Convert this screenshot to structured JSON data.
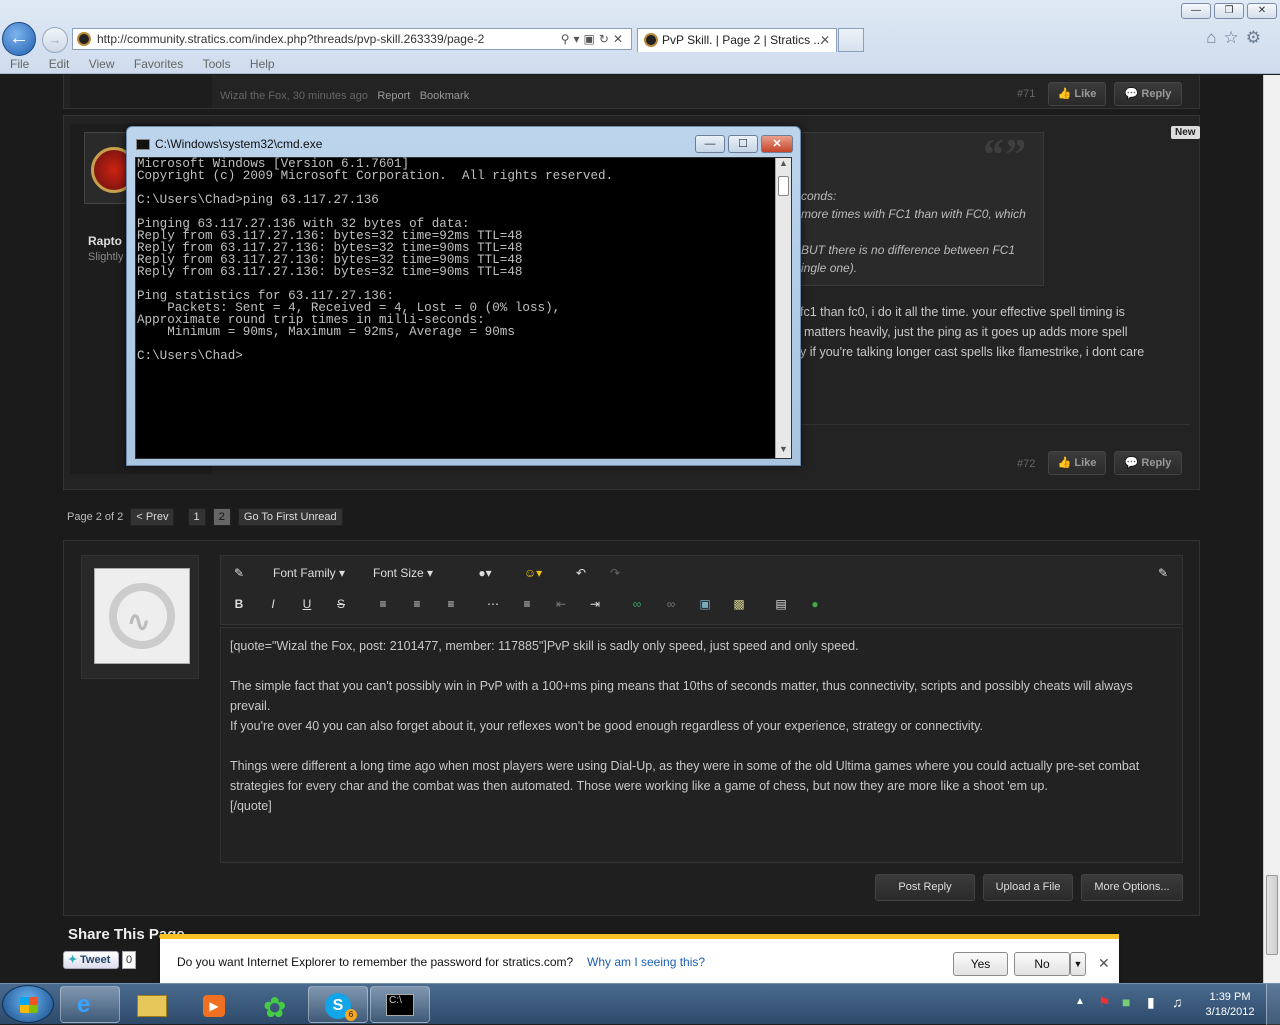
{
  "browser": {
    "url": "http://community.stratics.com/index.php?threads/pvp-skill.263339/page-2",
    "tab_title": "PvP Skill. | Page 2 | Stratics ...",
    "menu": [
      "File",
      "Edit",
      "View",
      "Favorites",
      "Tools",
      "Help"
    ],
    "window_buttons": [
      "minimize",
      "maximize",
      "close"
    ]
  },
  "post71": {
    "byline": "Wizal the Fox, 30 minutes ago",
    "report": "Report",
    "bookmark": "Bookmark",
    "number": "#71",
    "like": "Like",
    "reply": "Reply"
  },
  "post72": {
    "new_badge": "New",
    "author_short": "Rapto",
    "author_rank_short": "Slightly",
    "quote_lines": [
      "conds:",
      "more times with FC1 than with FC0, which",
      "BUT there is no difference between FC1",
      "ingle one)."
    ],
    "body_lines": [
      "fc1 than fc0, i do it all the time. your effective spell timing is",
      "matters heavily, just the ping as it goes up adds more spell",
      "y if you're talking longer cast spells like flamestrike, i dont care"
    ],
    "number": "#72",
    "like": "Like",
    "reply": "Reply"
  },
  "cmd": {
    "title": "C:\\Windows\\system32\\cmd.exe",
    "output": "Microsoft Windows [Version 6.1.7601]\nCopyright (c) 2009 Microsoft Corporation.  All rights reserved.\n\nC:\\Users\\Chad>ping 63.117.27.136\n\nPinging 63.117.27.136 with 32 bytes of data:\nReply from 63.117.27.136: bytes=32 time=92ms TTL=48\nReply from 63.117.27.136: bytes=32 time=90ms TTL=48\nReply from 63.117.27.136: bytes=32 time=90ms TTL=48\nReply from 63.117.27.136: bytes=32 time=90ms TTL=48\n\nPing statistics for 63.117.27.136:\n    Packets: Sent = 4, Received = 4, Lost = 0 (0% loss),\nApproximate round trip times in milli-seconds:\n    Minimum = 90ms, Maximum = 92ms, Average = 90ms\n\nC:\\Users\\Chad>"
  },
  "pagination": {
    "label": "Page 2 of 2",
    "prev": "< Prev",
    "pages": [
      "1",
      "2"
    ],
    "first_unread": "Go To First Unread"
  },
  "editor": {
    "font_family": "Font Family",
    "font_size": "Font Size",
    "text_lines": [
      "[quote=\"Wizal the Fox, post: 2101477, member: 117885\"]PvP skill is sadly only speed, just speed and only speed.",
      "",
      "The simple fact that you can't possibly win in PvP with a 100+ms ping means that 10ths of seconds matter, thus connectivity, scripts and possibly cheats will always prevail.",
      "If you're over 40 you can also forget about it, your reflexes won't be good enough regardless of your experience, strategy or connectivity.",
      "",
      "Things were different a long time ago when most players were using Dial-Up, as they were in some of the old Ultima games where you could actually pre-set combat strategies for every char and the combat was then automated. Those were working like a game of chess, but now they are more like a shoot 'em up.",
      "[/quote]"
    ],
    "post_reply": "Post Reply",
    "upload": "Upload a File",
    "more_options": "More Options..."
  },
  "share": {
    "heading": "Share This Page",
    "tweet": "Tweet",
    "tweet_count": "0"
  },
  "password_bar": {
    "message": "Do you want Internet Explorer to remember the password for stratics.com?",
    "why": "Why am I seeing this?",
    "yes": "Yes",
    "no": "No"
  },
  "taskbar": {
    "time": "1:39 PM",
    "date": "3/18/2012",
    "skype_badge": "6"
  }
}
